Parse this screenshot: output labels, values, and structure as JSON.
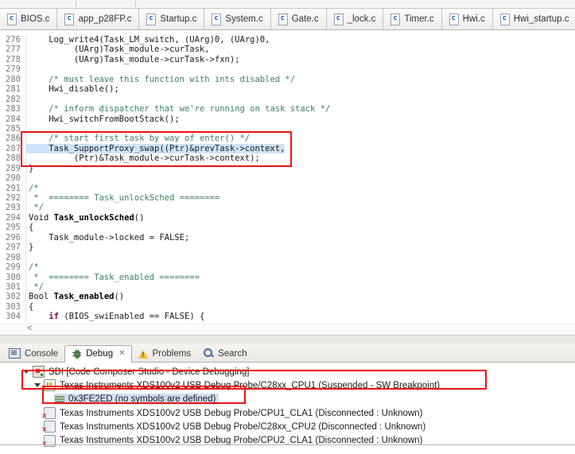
{
  "editor": {
    "tabs": [
      "BIOS.c",
      "app_p28FP.c",
      "Startup.c",
      "System.c",
      "Gate.c",
      "_lock.c",
      "Timer.c",
      "Hwi.c",
      "Hwi_startup.c"
    ],
    "code_lines": [
      {
        "n": 276,
        "seg": [
          [
            "p",
            "    Log_write4(Task_LM_switch, (UArg)0, (UArg)0,"
          ]
        ]
      },
      {
        "n": 277,
        "seg": [
          [
            "p",
            "         (UArg)Task_module->curTask,"
          ]
        ]
      },
      {
        "n": 278,
        "seg": [
          [
            "p",
            "         (UArg)Task_module->curTask->fxn);"
          ]
        ]
      },
      {
        "n": 279,
        "seg": []
      },
      {
        "n": 280,
        "seg": [
          [
            "p",
            "    "
          ],
          [
            "c",
            "/* must leave this function with ints disabled */"
          ]
        ]
      },
      {
        "n": 281,
        "seg": [
          [
            "p",
            "    Hwi_disable();"
          ]
        ]
      },
      {
        "n": 282,
        "seg": []
      },
      {
        "n": 283,
        "seg": [
          [
            "p",
            "    "
          ],
          [
            "c",
            "/* inform dispatcher that we're running on task stack */"
          ]
        ]
      },
      {
        "n": 284,
        "seg": [
          [
            "p",
            "    Hwi_switchFromBootStack();"
          ]
        ]
      },
      {
        "n": 285,
        "seg": []
      },
      {
        "n": 286,
        "seg": [
          [
            "p",
            "    "
          ],
          [
            "c",
            "/* start first task by way of enter() */"
          ]
        ]
      },
      {
        "n": 287,
        "hl": true,
        "seg": [
          [
            "p",
            "    Task_SupportProxy_swap((Ptr)&prevTask->context,"
          ]
        ]
      },
      {
        "n": 288,
        "seg": [
          [
            "p",
            "         (Ptr)&Task_module->curTask->context);"
          ]
        ]
      },
      {
        "n": 289,
        "seg": [
          [
            "p",
            "}"
          ]
        ]
      },
      {
        "n": 290,
        "seg": []
      },
      {
        "n": 291,
        "seg": [
          [
            "c",
            "/*"
          ]
        ]
      },
      {
        "n": 292,
        "seg": [
          [
            "c",
            " *  ======== Task_unlockSched ========"
          ]
        ]
      },
      {
        "n": 293,
        "seg": [
          [
            "c",
            " */"
          ]
        ]
      },
      {
        "n": 294,
        "seg": [
          [
            "p",
            "Void "
          ],
          [
            "b",
            "Task_unlockSched"
          ],
          [
            "p",
            "()"
          ]
        ]
      },
      {
        "n": 295,
        "seg": [
          [
            "p",
            "{"
          ]
        ]
      },
      {
        "n": 296,
        "seg": [
          [
            "p",
            "    Task_module->locked = FALSE;"
          ]
        ]
      },
      {
        "n": 297,
        "seg": [
          [
            "p",
            "}"
          ]
        ]
      },
      {
        "n": 298,
        "seg": []
      },
      {
        "n": 299,
        "seg": [
          [
            "c",
            "/*"
          ]
        ]
      },
      {
        "n": 300,
        "seg": [
          [
            "c",
            " *  ======== Task_enabled ========"
          ]
        ]
      },
      {
        "n": 301,
        "seg": [
          [
            "c",
            " */"
          ]
        ]
      },
      {
        "n": 302,
        "seg": [
          [
            "p",
            "Bool "
          ],
          [
            "b",
            "Task_enabled"
          ],
          [
            "p",
            "()"
          ]
        ]
      },
      {
        "n": 303,
        "seg": [
          [
            "p",
            "{"
          ]
        ]
      },
      {
        "n": 304,
        "seg": [
          [
            "p",
            "    "
          ],
          [
            "k",
            "if"
          ],
          [
            "p",
            " (BIOS_swiEnabled == FALSE) {"
          ]
        ]
      }
    ]
  },
  "panel": {
    "tabs": [
      {
        "label": "Console",
        "icon": "console",
        "active": false
      },
      {
        "label": "Debug",
        "icon": "debug",
        "active": true,
        "closable": true
      },
      {
        "label": "Problems",
        "icon": "problems",
        "active": false
      },
      {
        "label": "Search",
        "icon": "search",
        "active": false
      }
    ],
    "tree": [
      {
        "depth": 0,
        "expanded": true,
        "icon": "sdi-session",
        "label": "SDI [Code Composer Studio - Device Debugging]"
      },
      {
        "depth": 1,
        "expanded": true,
        "icon": "cpu-suspended",
        "label": "Texas Instruments XDS100v2 USB Debug Probe/C28xx_CPU1 (Suspended - SW Breakpoint)"
      },
      {
        "depth": 2,
        "icon": "stack-frame",
        "label": "0x3FE2ED  (no symbols are defined)",
        "selected": true
      },
      {
        "depth": 1,
        "icon": "cpu-disconnected",
        "label": "Texas Instruments XDS100v2 USB Debug Probe/CPU1_CLA1 (Disconnected : Unknown)"
      },
      {
        "depth": 1,
        "icon": "cpu-disconnected",
        "label": "Texas Instruments XDS100v2 USB Debug Probe/C28xx_CPU2 (Disconnected : Unknown)"
      },
      {
        "depth": 1,
        "icon": "cpu-disconnected",
        "label": "Texas Instruments XDS100v2 USB Debug Probe/CPU2_CLA1 (Disconnected : Unknown)"
      }
    ]
  },
  "colors": {
    "annotation_red": "#ee1111",
    "comment_green": "#3F7F5F",
    "keyword_purple": "#7F0055",
    "line_highlight_blue": "#cfe3f7",
    "tree_selection_blue": "#cfe0f2"
  }
}
